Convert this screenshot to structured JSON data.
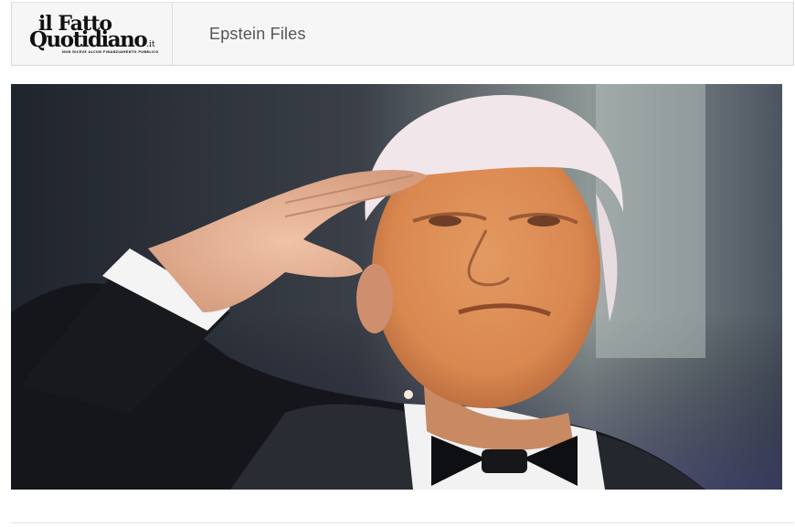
{
  "header": {
    "logo_line1": "il Fatto",
    "logo_line2": "Quotidiano",
    "logo_suffix": ".it",
    "logo_tagline": "NON RICEVE ALCUN FINANZIAMENTO PUBBLICO",
    "section_title": "Epstein Files"
  },
  "hero": {
    "subject": "man in tuxedo saluting"
  }
}
